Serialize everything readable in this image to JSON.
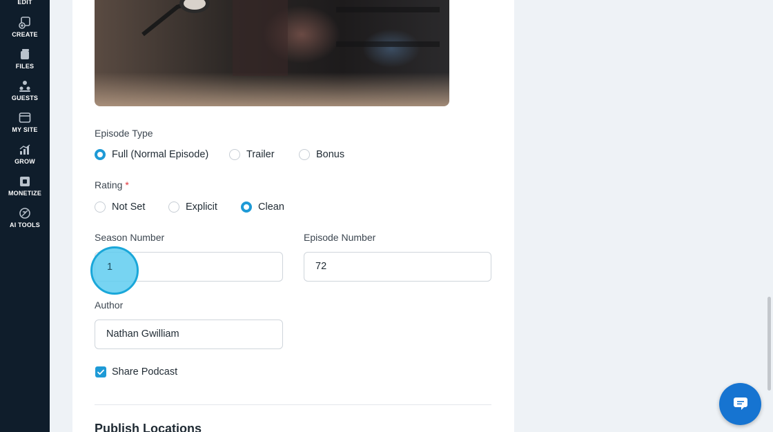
{
  "sidebar": {
    "items": [
      {
        "label": "EDIT",
        "icon": "edit-icon"
      },
      {
        "label": "CREATE",
        "icon": "create-icon"
      },
      {
        "label": "FILES",
        "icon": "files-icon"
      },
      {
        "label": "GUESTS",
        "icon": "guests-icon"
      },
      {
        "label": "MY SITE",
        "icon": "my-site-icon"
      },
      {
        "label": "GROW",
        "icon": "grow-icon"
      },
      {
        "label": "MONETIZE",
        "icon": "monetize-icon"
      },
      {
        "label": "AI TOOLS",
        "icon": "ai-tools-icon"
      }
    ]
  },
  "form": {
    "episode_type": {
      "label": "Episode Type",
      "options": [
        "Full (Normal Episode)",
        "Trailer",
        "Bonus"
      ],
      "selected": "Full (Normal Episode)"
    },
    "rating": {
      "label": "Rating",
      "required_mark": "*",
      "options": [
        "Not Set",
        "Explicit",
        "Clean"
      ],
      "selected": "Clean"
    },
    "season_number": {
      "label": "Season Number",
      "value": "1"
    },
    "episode_number": {
      "label": "Episode Number",
      "value": "72"
    },
    "author": {
      "label": "Author",
      "value": "Nathan Gwilliam"
    },
    "share_podcast": {
      "label": "Share Podcast",
      "checked": true
    },
    "publish_locations_title": "Publish Locations"
  },
  "colors": {
    "sidebar_bg": "#0f1d2b",
    "accent": "#1e9ad6",
    "chat_button": "#1674d1"
  }
}
